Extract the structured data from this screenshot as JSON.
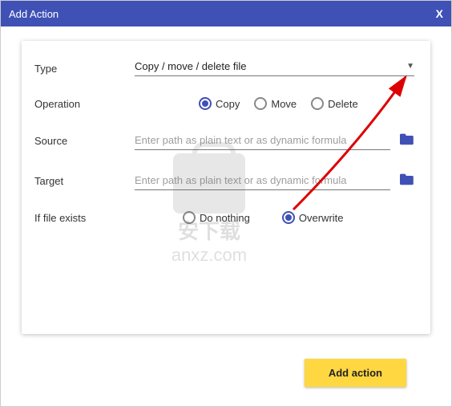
{
  "title_bar": {
    "title": "Add Action",
    "close": "X"
  },
  "labels": {
    "type": "Type",
    "operation": "Operation",
    "source": "Source",
    "target": "Target",
    "if_exists": "If file exists"
  },
  "type_select": {
    "value": "Copy / move / delete file"
  },
  "operation_opts": {
    "copy": "Copy",
    "move": "Move",
    "delete": "Delete",
    "selected": "copy"
  },
  "source": {
    "placeholder": "Enter path as plain text or as dynamic formula",
    "value": ""
  },
  "target": {
    "placeholder": "Enter path as plain text or as dynamic formula",
    "value": ""
  },
  "if_exists_opts": {
    "do_nothing": "Do nothing",
    "overwrite": "Overwrite",
    "selected": "overwrite"
  },
  "buttons": {
    "add": "Add action"
  },
  "watermark": {
    "line1": "安下载",
    "line2": "anxz.com"
  }
}
